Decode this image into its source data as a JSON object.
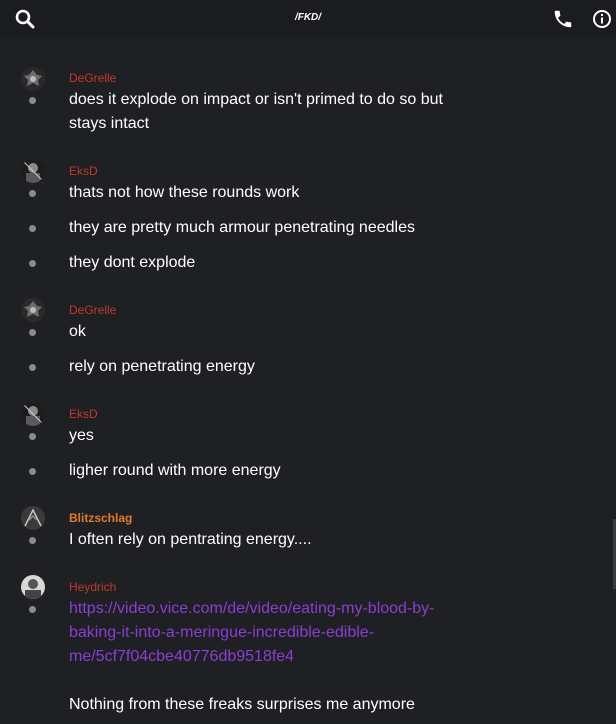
{
  "header": {
    "title": "/FKD/",
    "search_icon": "search-icon",
    "call_icon": "phone-icon",
    "info_icon": "info-icon"
  },
  "colors": {
    "red_user": "#c0392b",
    "orange_user": "#e07b28",
    "link": "#8a3ed1"
  },
  "messages": [
    {
      "user": "DeGrelle",
      "user_color": "#c0392b",
      "lines": [
        "does it explode on impact or isn't primed to do so but stays intact"
      ]
    },
    {
      "user": "EksD",
      "user_color": "#c0392b",
      "lines": [
        "thats not how these rounds work",
        "they are pretty much armour penetrating needles",
        "they dont explode"
      ]
    },
    {
      "user": "DeGrelle",
      "user_color": "#c0392b",
      "lines": [
        "ok",
        "rely on penetrating energy"
      ]
    },
    {
      "user": "EksD",
      "user_color": "#c0392b",
      "lines": [
        "yes",
        "ligher round with more energy"
      ]
    },
    {
      "user": "Blitzschlag",
      "user_color": "#e07b28",
      "lines": [
        "I often rely on pentrating energy...."
      ]
    },
    {
      "user": "Heydrich",
      "user_color": "#c0392b",
      "link": "https://video.vice.com/de/video/eating-my-blood-by-baking-it-into-a-meringue-incredible-edible-me/5cf7f04cbe40776db9518fe4",
      "link_lines": [
        "https://video.vice.com/de/video/eating-my-blood-by-",
        "baking-it-into-a-meringue-incredible-edible-",
        "me/5cf7f04cbe40776db9518fe4"
      ],
      "after_link": "Nothing from these freaks surprises me anymore"
    }
  ]
}
